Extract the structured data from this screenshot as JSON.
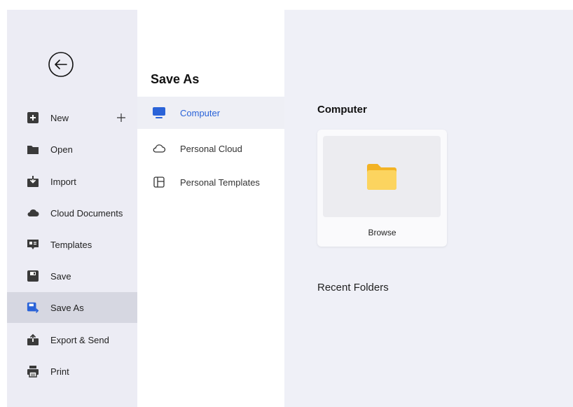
{
  "nav": {
    "items": [
      {
        "label": "New",
        "icon": "new-doc-icon"
      },
      {
        "label": "Open",
        "icon": "folder-open-icon"
      },
      {
        "label": "Import",
        "icon": "import-icon"
      },
      {
        "label": "Cloud Documents",
        "icon": "cloud-icon"
      },
      {
        "label": "Templates",
        "icon": "templates-icon"
      },
      {
        "label": "Save",
        "icon": "save-icon"
      },
      {
        "label": "Save As",
        "icon": "save-as-icon",
        "active": true
      },
      {
        "label": "Export & Send",
        "icon": "export-icon"
      },
      {
        "label": "Print",
        "icon": "print-icon"
      }
    ]
  },
  "save_as": {
    "title": "Save As",
    "locations": [
      {
        "label": "Computer",
        "icon": "monitor-icon",
        "active": true
      },
      {
        "label": "Personal Cloud",
        "icon": "cloud-outline-icon"
      },
      {
        "label": "Personal Templates",
        "icon": "template-layout-icon"
      }
    ]
  },
  "content": {
    "title": "Computer",
    "browse_label": "Browse",
    "recent_title": "Recent Folders"
  },
  "colors": {
    "accent": "#2a63d8",
    "folder": "#f9c640",
    "nav_bg": "#ececf4",
    "nav_active": "#d6d7e1",
    "content_bg": "#eff0f7"
  }
}
